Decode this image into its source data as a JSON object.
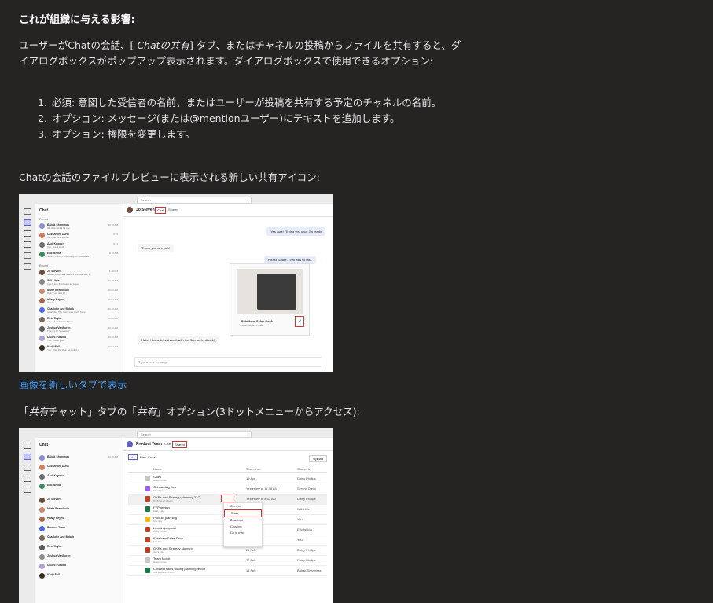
{
  "heading": "これが組織に与える影響:",
  "intro": {
    "part1": "ユーザーがChatの会話、[ ",
    "italic": "Chatの共有",
    "part2": "] タブ、またはチャネルの投稿からファイルを共有すると、ダイアログボックスがポップアップ表示されます。ダイアログボックスで使用できるオプション:"
  },
  "steps": [
    "必須: 意図した受信者の名前、またはユーザーが投稿を共有する予定のチャネルの名前。",
    "オプション: メッセージ(または@mentionユーザー)にテキストを追加します。",
    "オプション: 権限を変更します。"
  ],
  "caption1": "Chatの会話のファイルプレビューに表示される新しい共有アイコン:",
  "link_text": "画像を新しいタブで表示",
  "caption2": {
    "open": "「",
    "italic1": "共有",
    "mid1": "チャット」タブの「",
    "italic2": "共有",
    "mid2": "」オプション(3ドットメニューからアクセス):"
  },
  "shot1": {
    "search": "Search",
    "list_title": "Chat",
    "section_pinned": "Pinned",
    "section_recent": "Recent",
    "contacts": [
      {
        "name": "Babak Shammas",
        "preview": "Ok, that works for me",
        "time": "10:15 AM"
      },
      {
        "name": "Cassandra Dunn",
        "preview": "Can you look at this?",
        "time": "9:50"
      },
      {
        "name": "Aadi Kapoor",
        "preview": "You: Great work",
        "time": "9:41"
      },
      {
        "name": "Eric Ishida",
        "preview": "Sure, I'll set up something for next week",
        "time": "9:40 AM"
      },
      {
        "name": "Jo Stevens",
        "preview": "Haha I know, let's share it with the Sea T...",
        "time": "1:38 PM"
      },
      {
        "name": "Will Little",
        "preview": "I don't see that being an issue",
        "time": "10:48 AM"
      },
      {
        "name": "Marie Beaudouin",
        "preview": "Didn't you see it?",
        "time": "10:00 AM"
      },
      {
        "name": "Hilary Reyes",
        "preview": "I'll look",
        "time": "10:53 AM"
      },
      {
        "name": "Charlotte and Babak",
        "preview": "Charlotte: The client was pretty happy",
        "time": "10:48 AM"
      },
      {
        "name": "Reta Taylor",
        "preview": "Ah, ok I understand now.",
        "time": "10:00 AM"
      },
      {
        "name": "Joshua VanBuren",
        "preview": "Thanks for reviewing!",
        "time": "10:10 AM"
      },
      {
        "name": "Daichi Fukuda",
        "preview": "You: Thank you!",
        "time": "10:20 AM"
      },
      {
        "name": "Kadji Bell",
        "preview": "You: I like the idea, let's pitch it",
        "time": "10:02 AM"
      }
    ],
    "chat_name": "Jo Stevens",
    "tab_chat": "Chat",
    "tab_shared": "Shared",
    "msg_me1": "Yes sure! I'll ping you once I'm ready",
    "msg_them1": "Thank you so much!",
    "msg_me2": "Please Share. That was so fast.",
    "file_title": "Fabrikam Sales Deck",
    "file_sub": "Sales Report 5 Files",
    "msg_them2": "Haha I know, let's share it with the Sea for feedback?",
    "compose": "Type a new message"
  },
  "shot2": {
    "search": "Search",
    "list_title": "Chat",
    "team_name": "Product Team",
    "tab_chat": "Chat",
    "tab_shared": "Shared",
    "filter_all": "All",
    "filter_files": "Files",
    "filter_links": "Links",
    "upload": "Upload",
    "col_name": "Name",
    "col_shared_on": "Shared on",
    "col_shared_by": "Shared by",
    "files": [
      {
        "name": "Sales",
        "sub": "Daisy's Files",
        "mod": "19 Apr",
        "by": "Daisy Phillips",
        "color": "#c8c6c4"
      },
      {
        "name": "Onboarding flow",
        "sub": "Figma.com",
        "mod": "Yesterday at 11:38 AM",
        "by": "Serena Davis",
        "color": "#a259ff"
      },
      {
        "name": "OKRs and Strategy planning 23/2",
        "sub": "Dir B Design Team",
        "mod": "Yesterday at 8:57 AM",
        "by": "Daisy Phillips",
        "color": "#c43e1c"
      },
      {
        "name": "FYPlanning",
        "sub": "Kathy Hay",
        "mod": "",
        "by": "Will Little",
        "color": "#107c41"
      },
      {
        "name": "Product planning",
        "sub": "Kris Hay",
        "mod": "",
        "by": "You",
        "color": "#ffb900"
      },
      {
        "name": "Lincoln proposal",
        "sub": "Daisy's Files",
        "mod": "",
        "by": "Eric Ishida",
        "color": "#c43e1c"
      },
      {
        "name": "Fabrikam Sales Deck",
        "sub": "Kris Hay",
        "mod": "",
        "by": "You",
        "color": "#c43e1c"
      },
      {
        "name": "OKRs and Strategy planning",
        "sub": "Kim's Files",
        "mod": "21 Feb",
        "by": "Daisy Phillips",
        "color": "#c43e1c"
      },
      {
        "name": "Team toolkit",
        "sub": "Daisy's Files",
        "mod": "21 Feb",
        "by": "Daisy Phillips",
        "color": "#c8c6c4"
      },
      {
        "name": "Connect sales tooling planning report",
        "sub": "Kris.sharepoint.com",
        "mod": "15 Feb",
        "by": "Babak Shammas",
        "color": "#107c41"
      }
    ],
    "menu": [
      "Open in",
      "Share",
      "Download",
      "Copy link",
      "Go to chat"
    ]
  }
}
